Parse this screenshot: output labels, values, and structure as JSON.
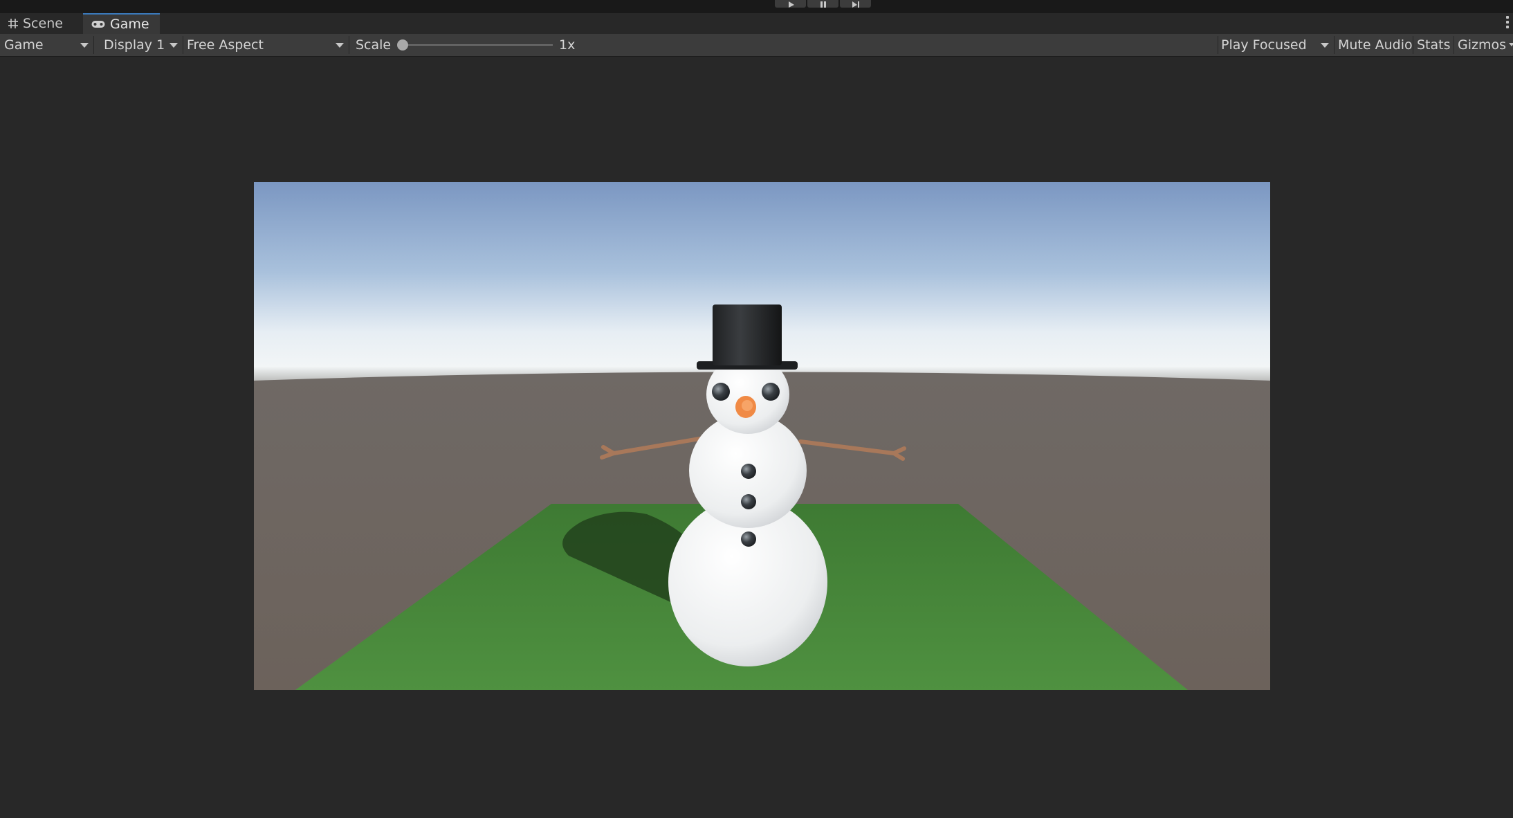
{
  "window": {
    "tabs": [
      {
        "label": "Scene",
        "icon": "grid-icon",
        "active": false
      },
      {
        "label": "Game",
        "icon": "gamepad-icon",
        "active": true
      }
    ]
  },
  "play_controls": {
    "buttons": [
      "play-icon",
      "pause-icon",
      "step-icon"
    ]
  },
  "toolbar": {
    "view_select": "Game",
    "display_select": "Display 1",
    "aspect_select": "Free Aspect",
    "scale_label": "Scale",
    "scale_value": "1x",
    "play_mode_select": "Play Focused",
    "mute_audio_label": "Mute Audio",
    "stats_label": "Stats",
    "gizmos_label": "Gizmos"
  },
  "colors": {
    "editor_background": "#282828",
    "toolbar_background": "#3c3c3c",
    "active_tab_accent": "#3a79bb"
  }
}
